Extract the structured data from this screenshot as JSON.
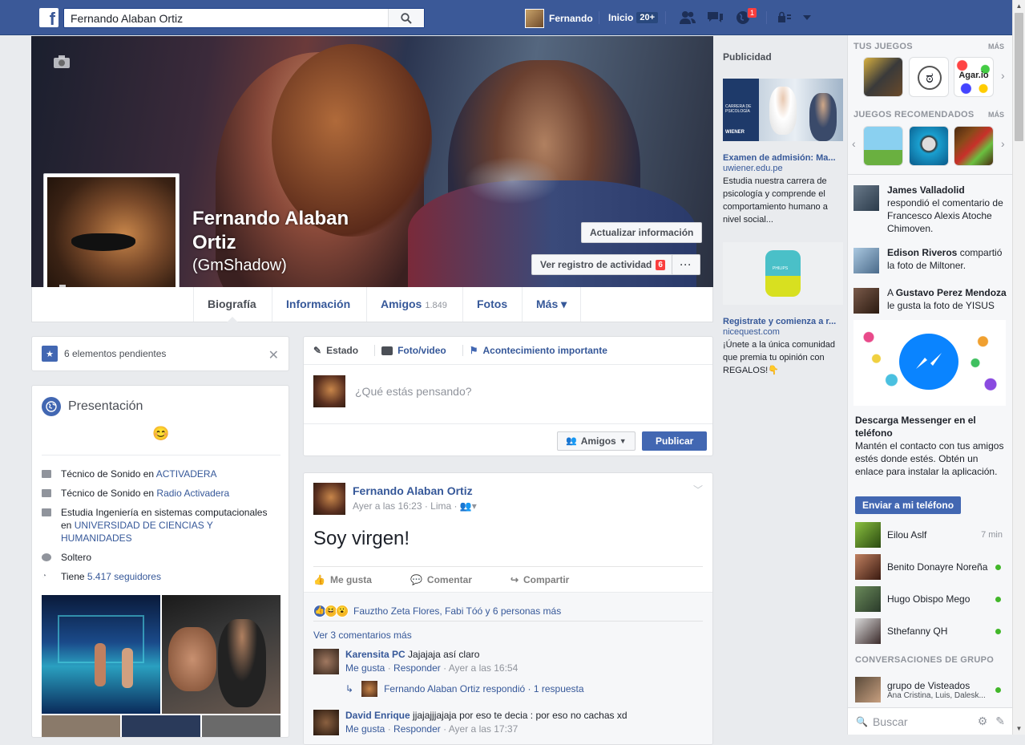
{
  "topbar": {
    "search_value": "Fernando Alaban Ortiz",
    "user_name": "Fernando",
    "home_label": "Inicio",
    "home_count": "20+",
    "notif_count": "1"
  },
  "profile": {
    "name": "Fernando Alaban Ortiz",
    "alt_name": "(GmShadow)",
    "update_btn": "Actualizar información",
    "activity_btn": "Ver registro de actividad",
    "activity_count": "6",
    "more_btn": "···"
  },
  "tabs": [
    {
      "label": "Biografía"
    },
    {
      "label": "Información"
    },
    {
      "label": "Amigos",
      "count": "1.849"
    },
    {
      "label": "Fotos"
    },
    {
      "label": "Más ▾"
    }
  ],
  "pending": {
    "text": "6 elementos pendientes"
  },
  "intro": {
    "title": "Presentación",
    "emoji": "😊",
    "rows": [
      {
        "pre": "Técnico de Sonido en ",
        "link": "ACTIVADERA"
      },
      {
        "pre": "Técnico de Sonido en ",
        "link": "Radio Activadera"
      },
      {
        "pre": "Estudia Ingeniería en sistemas computacionales en ",
        "link": "UNIVERSIDAD DE CIENCIAS Y HUMANIDADES"
      },
      {
        "pre": "Soltero",
        "link": ""
      },
      {
        "pre": "Tiene ",
        "link": "5.417 seguidores"
      }
    ]
  },
  "composer": {
    "tab_status": "Estado",
    "tab_photo": "Foto/video",
    "tab_event": "Acontecimiento importante",
    "placeholder": "¿Qué estás pensando?",
    "audience": "Amigos",
    "publish": "Publicar"
  },
  "post": {
    "author": "Fernando Alaban Ortiz",
    "meta": "Ayer a las 16:23 · Lima ·",
    "text": "Soy virgen!",
    "like": "Me gusta",
    "comment": "Comentar",
    "share": "Compartir",
    "reactions": "Fauztho Zeta Flores, Fabi Tóó y 6 personas más",
    "more_comments": "Ver 3 comentarios más",
    "comments": [
      {
        "who": "Karensita PC",
        "text": "Jajajaja así claro",
        "like": "Me gusta",
        "reply": "Responder",
        "time": "Ayer a las 16:54"
      },
      {
        "who": "David Enrique",
        "text": "jjajajjjajaja por eso te decia : por eso no cachas xd",
        "like": "Me gusta",
        "reply": "Responder",
        "time": "Ayer a las 17:37"
      }
    ],
    "reply_line": "Fernando Alaban Ortiz respondió · 1 respuesta"
  },
  "ads": {
    "header": "Publicidad",
    "ad1": {
      "title": "Examen de admisión: Ma...",
      "url": "uwiener.edu.pe",
      "desc": "Estudia nuestra carrera de psicología y comprende el comportamiento humano a nivel social...",
      "img_text1": "CARRERA DE PSICOLOGÍA",
      "img_text2": "WIENER"
    },
    "ad2": {
      "title": "Registrate y comienza a r...",
      "url": "nicequest.com",
      "desc": "¡Únete a la única comunidad que premia tu opinión con REGALOS!👇",
      "img_text": "PHILIPS"
    }
  },
  "sidebar": {
    "your_games": "TUS JUEGOS",
    "more": "MÁS",
    "recommended": "JUEGOS RECOMENDADOS",
    "agar": "Agar.io",
    "ticker": [
      {
        "b": "James Valladolid",
        "rest": " respondió el comentario de Francesco Alexis Atoche Chimoven."
      },
      {
        "b": "Edison Riveros",
        "rest": " compartió la foto de Miltoner."
      },
      {
        "pre": "A ",
        "b": "Gustavo Perez Mendoza",
        "rest": " le gusta la foto de YISUS"
      }
    ],
    "messenger_title": "Descarga Messenger en el teléfono",
    "messenger_desc": "Mantén el contacto con tus amigos estés donde estés. Obtén un enlace para instalar la aplicación.",
    "messenger_btn": "Enviar a mi teléfono",
    "chats": [
      {
        "name": "Eilou Aslf",
        "time": "7 min"
      },
      {
        "name": "Benito Donayre Noreña"
      },
      {
        "name": "Hugo Obispo Mego"
      },
      {
        "name": "Sthefanny QH"
      }
    ],
    "group_header": "CONVERSACIONES DE GRUPO",
    "group": {
      "name": "grupo de Visteados",
      "members": "Ana Cristina, Luis, Dalesk..."
    },
    "search_placeholder": "Buscar"
  },
  "colors": {
    "brand": "#3b5998",
    "link": "#365899",
    "online": "#42b72a",
    "badge": "#fa3e3e"
  }
}
